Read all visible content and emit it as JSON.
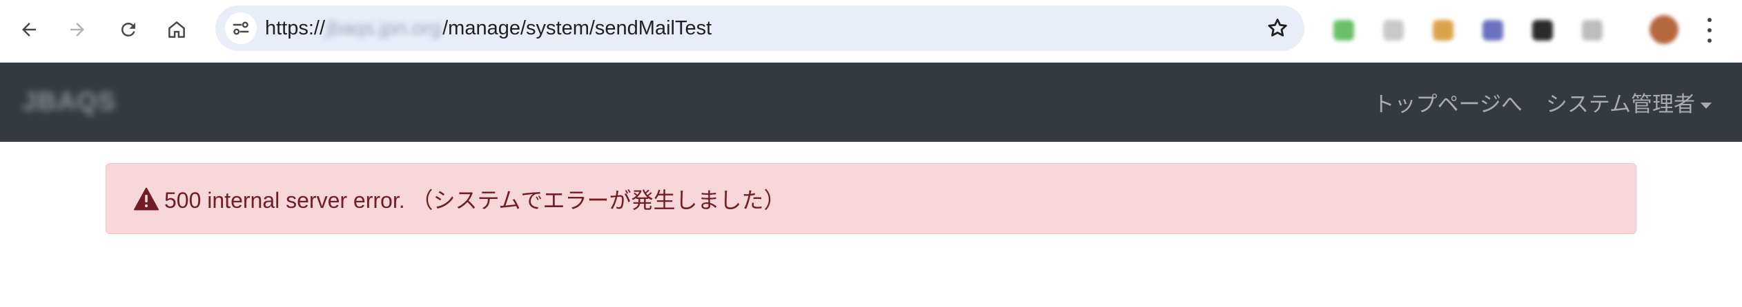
{
  "browser": {
    "url_prefix": "https://",
    "url_host_blurred": "jbaqs.jpn.org",
    "url_path": "/manage/system/sendMailTest",
    "icons": {
      "back": "arrow-left-icon",
      "forward": "arrow-right-icon",
      "reload": "reload-icon",
      "home": "home-icon",
      "site_info": "tune-icon",
      "bookmark": "star-icon",
      "menu": "kebab-menu-icon"
    },
    "extension_colors": [
      "#6bbf6b",
      "#c9c9c9",
      "#d9a34a",
      "#6b72c2",
      "#2b2b2b",
      "#bdbdbd"
    ]
  },
  "navbar": {
    "brand": "JBAQS",
    "links": [
      {
        "label": "トップページへ"
      },
      {
        "label": "システム管理者"
      }
    ],
    "bg_color": "#343a40"
  },
  "alert": {
    "icon": "warning-triangle-icon",
    "message": "500 internal server error. （システムでエラーが発生しました）",
    "bg_color": "#f8d7da",
    "text_color": "#721c24"
  }
}
